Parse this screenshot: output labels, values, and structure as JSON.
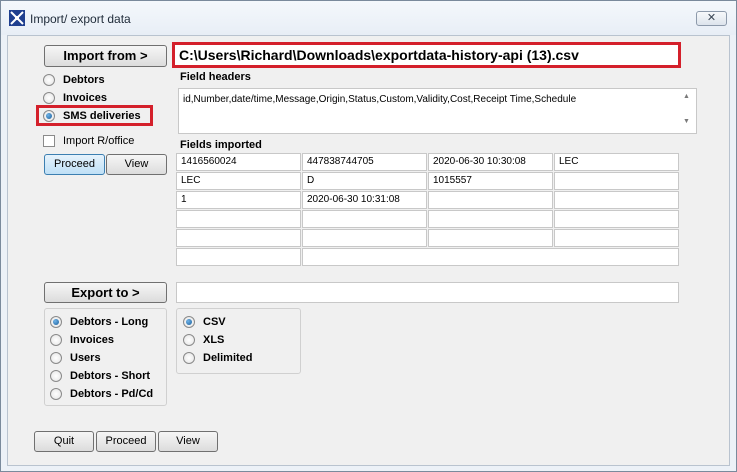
{
  "window": {
    "title": "Import/ export data",
    "close_glyph": "✕"
  },
  "import": {
    "button_label": "Import from >",
    "file_path": "C:\\Users\\Richard\\Downloads\\exportdata-history-api (13).csv",
    "options": [
      {
        "label": "Debtors",
        "selected": false
      },
      {
        "label": "Invoices",
        "selected": false
      },
      {
        "label": "SMS deliveries",
        "selected": true
      }
    ],
    "import_r_office_label": "Import R/office",
    "proceed_label": "Proceed",
    "view_label": "View"
  },
  "field_headers": {
    "label": "Field headers",
    "value": "id,Number,date/time,Message,Origin,Status,Custom,Validity,Cost,Receipt Time,Schedule"
  },
  "fields_imported": {
    "label": "Fields imported",
    "rows": [
      [
        "1416560024",
        "447838744705",
        "2020-06-30 10:30:08",
        "LEC"
      ],
      [
        "LEC",
        "D",
        "1015557",
        ""
      ],
      [
        "1",
        "2020-06-30 10:31:08",
        "",
        ""
      ],
      [
        "",
        "",
        "",
        ""
      ],
      [
        "",
        "",
        "",
        ""
      ]
    ],
    "last_row": [
      "",
      ""
    ]
  },
  "export": {
    "button_label": "Export to >",
    "path_value": "",
    "targets": [
      {
        "label": "Debtors - Long",
        "selected": true
      },
      {
        "label": "Invoices",
        "selected": false
      },
      {
        "label": "Users",
        "selected": false
      },
      {
        "label": "Debtors - Short",
        "selected": false
      },
      {
        "label": "Debtors - Pd/Cd",
        "selected": false
      }
    ],
    "formats": [
      {
        "label": "CSV",
        "selected": true
      },
      {
        "label": "XLS",
        "selected": false
      },
      {
        "label": "Delimited",
        "selected": false
      }
    ]
  },
  "footer": {
    "quit_label": "Quit",
    "proceed_label": "Proceed",
    "view_label": "View"
  },
  "colors": {
    "highlight": "#d4202b",
    "radio_selected": "#1b5e9a"
  }
}
